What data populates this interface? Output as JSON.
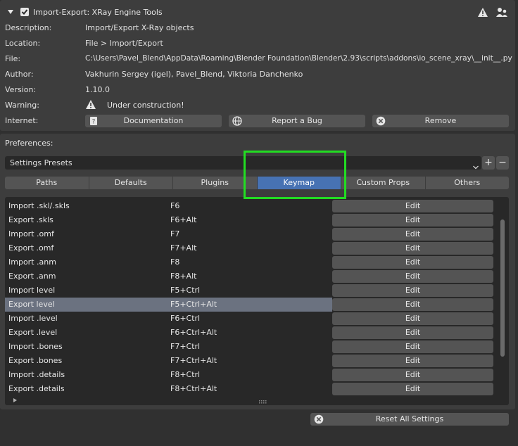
{
  "header": {
    "title": "Import-Export: XRay Engine Tools",
    "checkbox_checked": true
  },
  "info": {
    "description_label": "Description:",
    "description_value": "Import/Export X-Ray objects",
    "location_label": "Location:",
    "location_value": "File > Import/Export",
    "file_label": "File:",
    "file_value": "C:\\Users\\Pavel_Blend\\AppData\\Roaming\\Blender Foundation\\Blender\\2.93\\scripts\\addons\\io_scene_xray\\__init__.py",
    "author_label": "Author:",
    "author_value": "Vakhurin Sergey (igel), Pavel_Blend, Viktoria Danchenko",
    "version_label": "Version:",
    "version_value": "1.10.0",
    "warning_label": "Warning:",
    "warning_value": "Under construction!",
    "internet_label": "Internet:",
    "documentation_btn": "Documentation",
    "report_bug_btn": "Report a Bug",
    "remove_btn": "Remove"
  },
  "preferences": {
    "label": "Preferences:",
    "presets_value": "Settings Presets",
    "add_symbol": "+",
    "remove_symbol": "−"
  },
  "tabs": [
    {
      "label": "Paths",
      "active": false
    },
    {
      "label": "Defaults",
      "active": false
    },
    {
      "label": "Plugins",
      "active": false
    },
    {
      "label": "Keymap",
      "active": true
    },
    {
      "label": "Custom Props",
      "active": false
    },
    {
      "label": "Others",
      "active": false
    }
  ],
  "keymap": {
    "edit_label": "Edit",
    "rows": [
      {
        "name": "Import .skl/.skls",
        "key": "F6",
        "selected": false
      },
      {
        "name": "Export .skls",
        "key": "F6+Alt",
        "selected": false
      },
      {
        "name": "Import .omf",
        "key": "F7",
        "selected": false
      },
      {
        "name": "Export .omf",
        "key": "F7+Alt",
        "selected": false
      },
      {
        "name": "Import .anm",
        "key": "F8",
        "selected": false
      },
      {
        "name": "Export .anm",
        "key": "F8+Alt",
        "selected": false
      },
      {
        "name": "Import level",
        "key": "F5+Ctrl",
        "selected": false
      },
      {
        "name": "Export level",
        "key": "F5+Ctrl+Alt",
        "selected": true
      },
      {
        "name": "Import .level",
        "key": "F6+Ctrl",
        "selected": false
      },
      {
        "name": "Export .level",
        "key": "F6+Ctrl+Alt",
        "selected": false
      },
      {
        "name": "Import .bones",
        "key": "F7+Ctrl",
        "selected": false
      },
      {
        "name": "Export .bones",
        "key": "F7+Ctrl+Alt",
        "selected": false
      },
      {
        "name": "Import .details",
        "key": "F8+Ctrl",
        "selected": false
      },
      {
        "name": "Export .details",
        "key": "F8+Ctrl+Alt",
        "selected": false
      }
    ]
  },
  "footer": {
    "reset_btn": "Reset All Settings"
  },
  "colors": {
    "accent": "#4772b3",
    "highlight": "#22dd22"
  }
}
